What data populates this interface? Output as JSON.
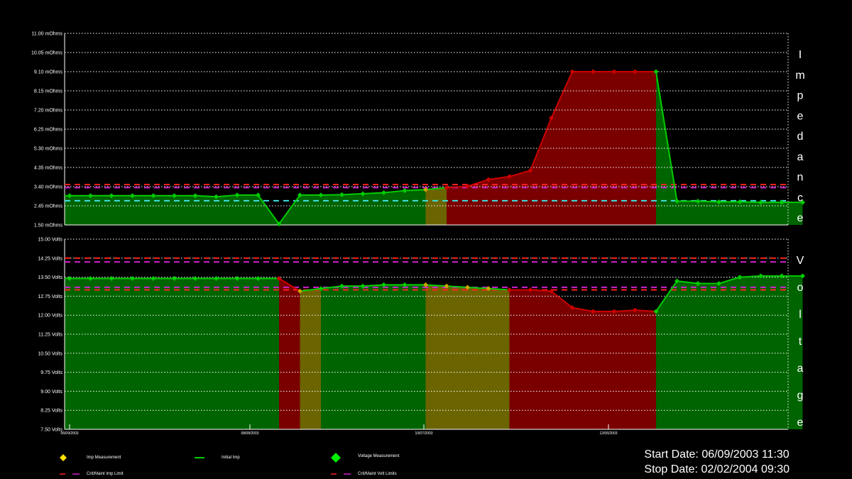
{
  "chart_data": [
    {
      "type": "area",
      "name": "Impedance",
      "side_label": "Impedance",
      "ylim": [
        1.5,
        11.0
      ],
      "ytick_labels": [
        "11.00 mOhms",
        "10.05 mOhms",
        "9.10 mOhms",
        "8.15 mOhms",
        "7.20 mOhms",
        "6.25 mOhms",
        "5.30 mOhms",
        "4.35 mOhms",
        "3.40 mOhms",
        "2.45 mOhms",
        "1.50 mOhms"
      ],
      "grid": true,
      "measurements": [
        2.95,
        2.95,
        2.95,
        2.95,
        2.95,
        2.95,
        2.95,
        2.9,
        2.98,
        2.98,
        1.55,
        2.98,
        2.98,
        3.0,
        3.05,
        3.1,
        3.2,
        3.25,
        3.35,
        3.42,
        3.75,
        3.9,
        4.2,
        6.8,
        9.1,
        9.1,
        9.1,
        9.1,
        9.1,
        2.68,
        2.68,
        2.65,
        2.65,
        2.62,
        2.62,
        2.62
      ],
      "status": [
        "ok",
        "ok",
        "ok",
        "ok",
        "ok",
        "ok",
        "ok",
        "ok",
        "ok",
        "ok",
        "ok",
        "ok",
        "ok",
        "ok",
        "ok",
        "ok",
        "ok",
        "warn",
        "crit",
        "crit",
        "crit",
        "crit",
        "crit",
        "crit",
        "crit",
        "crit",
        "crit",
        "crit",
        "ok",
        "ok",
        "ok",
        "ok",
        "ok",
        "ok",
        "ok"
      ],
      "initial_imp": 2.7,
      "limits": {
        "crit": 3.5,
        "maint": 3.35
      }
    },
    {
      "type": "area",
      "name": "Voltage",
      "side_label": "Voltage",
      "ylim": [
        7.5,
        15.0
      ],
      "ytick_labels": [
        "15.00 Volts",
        "14.25 Volts",
        "13.50 Volts",
        "12.75 Volts",
        "12.00 Volts",
        "11.25 Volts",
        "10.50 Volts",
        "9.75 Volts",
        "9.00 Volts",
        "8.25 Volts",
        "7.50 Volts"
      ],
      "grid": true,
      "measurements": [
        13.45,
        13.45,
        13.45,
        13.45,
        13.45,
        13.45,
        13.45,
        13.45,
        13.45,
        13.45,
        13.45,
        12.95,
        13.05,
        13.15,
        13.15,
        13.2,
        13.2,
        13.2,
        13.15,
        13.1,
        13.05,
        13.0,
        13.0,
        12.95,
        12.3,
        12.15,
        12.15,
        12.2,
        12.15,
        13.35,
        13.25,
        13.25,
        13.5,
        13.55,
        13.55,
        13.55
      ],
      "status": [
        "ok",
        "ok",
        "ok",
        "ok",
        "ok",
        "ok",
        "ok",
        "ok",
        "ok",
        "ok",
        "crit",
        "warn",
        "ok",
        "ok",
        "ok",
        "ok",
        "ok",
        "warn",
        "warn",
        "warn",
        "warn",
        "crit",
        "crit",
        "crit",
        "crit",
        "crit",
        "crit",
        "crit",
        "ok",
        "ok",
        "ok",
        "ok",
        "ok",
        "ok",
        "ok"
      ],
      "limits": {
        "crit_high": 14.25,
        "maint_high": 14.1,
        "crit_low": 13.0,
        "maint_low": 13.1
      }
    }
  ],
  "x_tick_labels": [
    "06/09/2003",
    "08/08/2003",
    "10/07/2003",
    "12/06/2003"
  ],
  "colors": {
    "ok_fill": "#006400",
    "warn_fill": "#6b6400",
    "crit_fill": "#7a0000",
    "ok_line": "#00cc00",
    "crit_line": "#cc0000",
    "warn_point": "#c9a500",
    "crit_limit": "#ff2020",
    "maint_limit": "#d020d0",
    "initial_imp": "#40e0e0",
    "grid": "#ffffff"
  },
  "legend": {
    "imp_measurement": "Imp Measurement",
    "initial_imp": "Initial Imp",
    "voltage_measurement": "Voltage Measurement",
    "imp_limit": "Crit/Maint Imp Limit",
    "volt_limits": "Crit/Maint Volt Limits"
  },
  "dates": {
    "start": "Start Date: 06/09/2003 11:30",
    "stop": "Stop Date: 02/02/2004 09:30"
  }
}
